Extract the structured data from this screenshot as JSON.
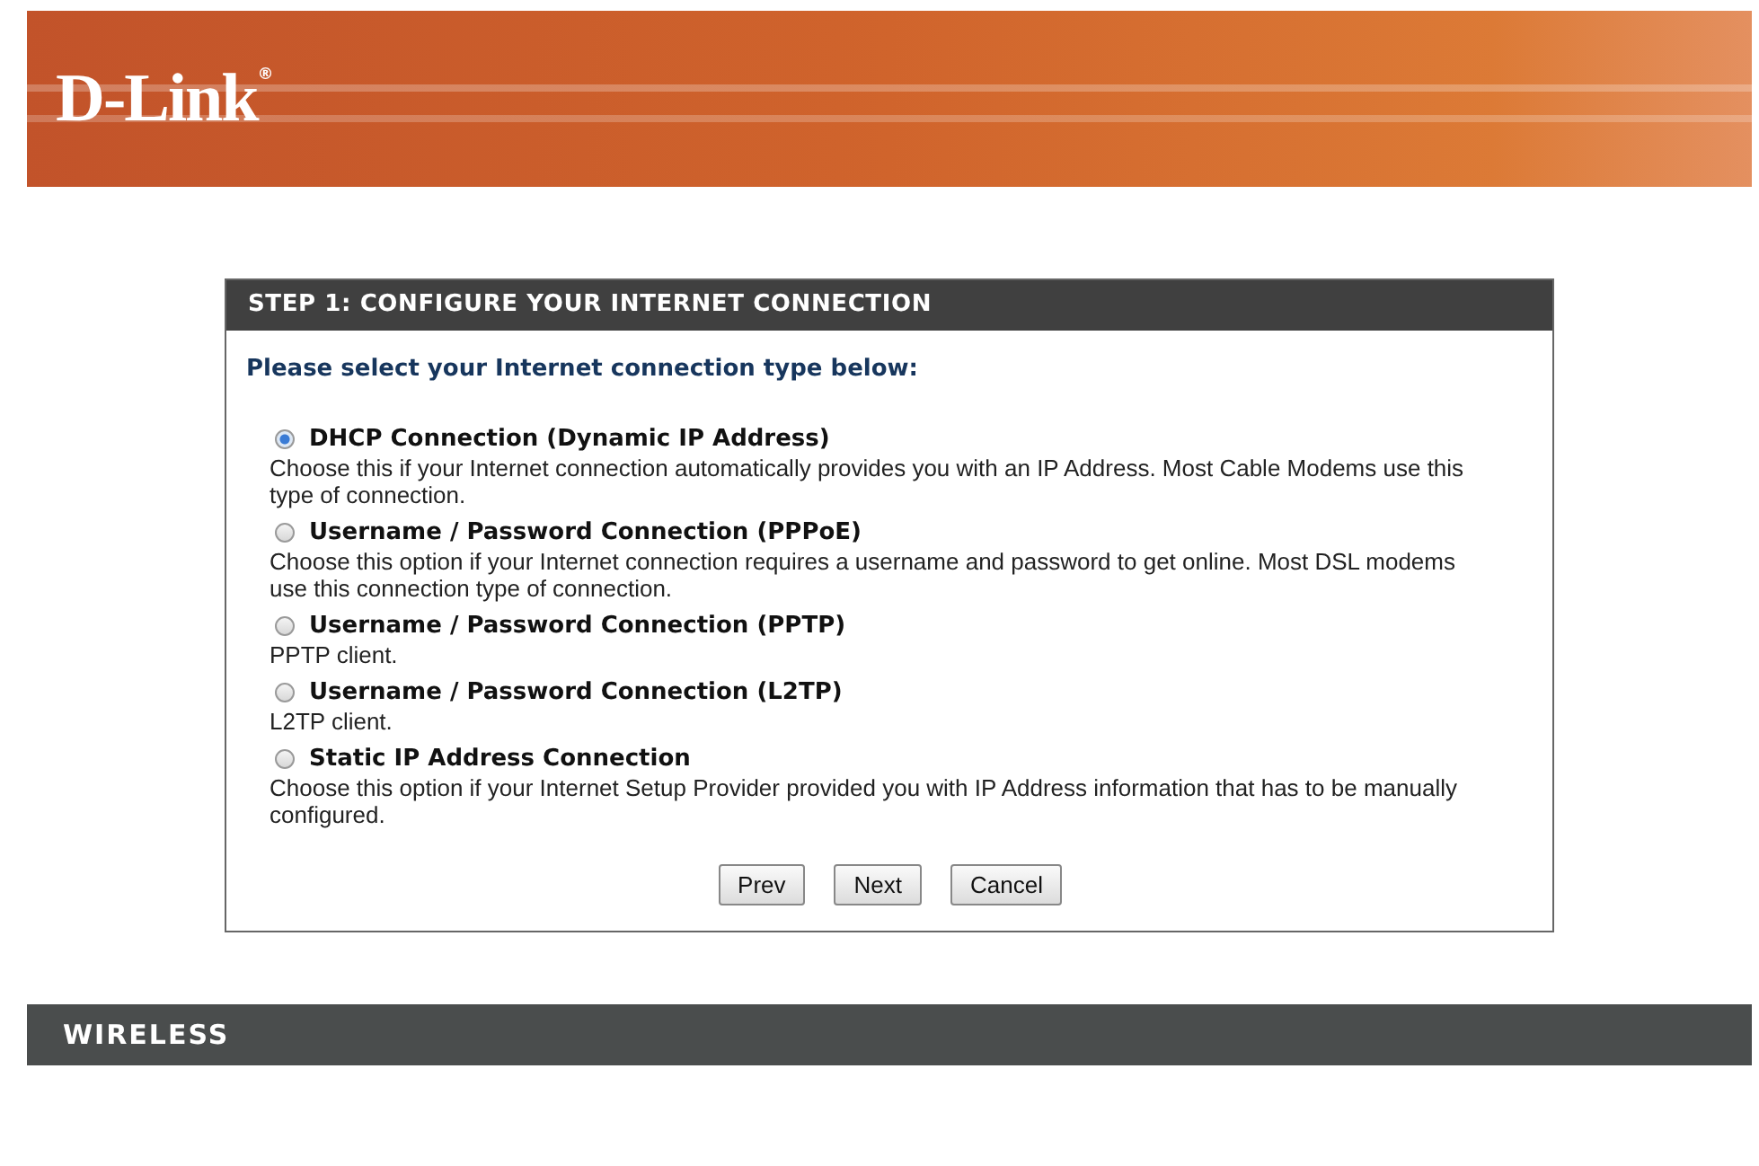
{
  "banner": {
    "logo": "D-Link",
    "logo_mark": "®"
  },
  "wizard": {
    "title": "STEP 1: CONFIGURE YOUR INTERNET CONNECTION",
    "prompt": "Please select your Internet connection type below:",
    "options": [
      {
        "label": "DHCP Connection (Dynamic IP Address)",
        "description": "Choose this if your Internet connection automatically provides you with an IP Address. Most Cable Modems use this type of connection.",
        "selected": true
      },
      {
        "label": "Username / Password Connection (PPPoE)",
        "description": "Choose this option if your Internet connection requires a username and password to get online. Most DSL modems use this connection type of connection.",
        "selected": false
      },
      {
        "label": "Username / Password Connection (PPTP)",
        "description": "PPTP client.",
        "selected": false
      },
      {
        "label": "Username / Password Connection (L2TP)",
        "description": "L2TP client.",
        "selected": false
      },
      {
        "label": "Static IP Address Connection",
        "description": "Choose this option if your Internet Setup Provider provided you with IP Address information that has to be manually configured.",
        "selected": false
      }
    ],
    "buttons": [
      "Prev",
      "Next",
      "Cancel"
    ]
  },
  "footer": {
    "title": "WIRELESS"
  }
}
